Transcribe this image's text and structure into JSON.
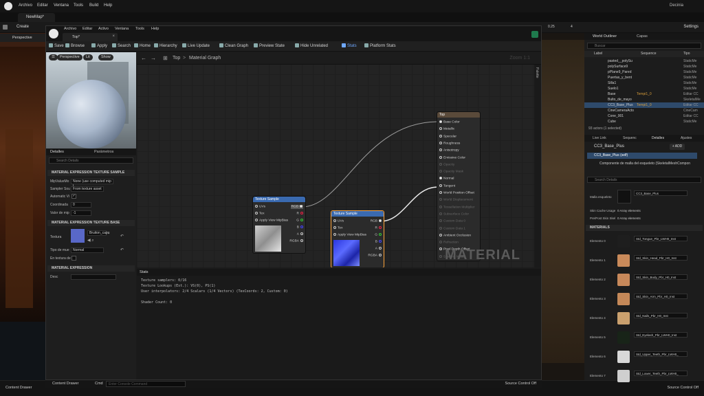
{
  "outer": {
    "menu": [
      "Archivo",
      "Editar",
      "Ventana",
      "Tools",
      "Build",
      "Help"
    ],
    "user": "Decinia",
    "map_tab": "NewMap*",
    "toolbar": {
      "create": "Create",
      "viewport_mode": "Perspective",
      "settings": "Settings",
      "fps": "0.25",
      "num": "4"
    },
    "bottom": {
      "content_drawer": "Content Drawer",
      "source_control": "Source Control Off"
    }
  },
  "mat": {
    "menu": [
      "Archivo",
      "Editar",
      "Activo",
      "Ventana",
      "Tools",
      "Help"
    ],
    "tab": "Top*",
    "toolbar": [
      "Save",
      "Browse",
      "Apply",
      "Search",
      "Home",
      "Hierarchy",
      "Live Update",
      "Clean Graph",
      "Preview State",
      "Hide Unrelated",
      "Stats",
      "Platform Stats"
    ],
    "viewport_pills": [
      "Perspective",
      "Lit",
      "Show"
    ],
    "details_tabs": [
      "Detalles",
      "Parámetros"
    ],
    "details_search": "Search Details",
    "sections": {
      "tex_sample": "MATERIAL EXPRESSION TEXTURE SAMPLE",
      "tex_base": "MATERIAL EXPRESSION TEXTURE BASE",
      "expr": "MATERIAL EXPRESSION"
    },
    "props": {
      "mip_label": "MipValueMo",
      "mip_value": "None (use computed mip l",
      "sampler_label": "Sampler Sou",
      "sampler_value": "From texture asset",
      "auto_label": "Automatic Vi",
      "coord_label": "Coordinada",
      "coord_value": "0",
      "const_label": "Valor de mip",
      "const_value": "-1",
      "texture_label": "Textura",
      "texture_value": "Bruiton_capu",
      "sampler_type_label": "Tipo de mue",
      "sampler_type_value": "Normal",
      "rangeunit_label": "En textura de",
      "desc_label": "Desc"
    },
    "graph": {
      "crumb_root": "Top",
      "crumb_sep": ">",
      "crumb_leaf": "Material Graph",
      "zoom": "Zoom 1:1",
      "watermark": "MATERIAL",
      "palette": "Palette"
    },
    "nodes": {
      "tex1_title": "Texture Sample",
      "tex2_title": "Texture Sample",
      "in_uvs": "UVs",
      "in_tex": "Tex",
      "in_mip": "Apply View MipBias",
      "out_rgb": "RGB",
      "out_r": "R",
      "out_g": "G",
      "out_b": "B",
      "out_a": "A",
      "out_rgba": "RGBA",
      "mat_title": "Top",
      "mat_pins": [
        {
          "label": "Base Color",
          "on": true
        },
        {
          "label": "Metallic",
          "on": true
        },
        {
          "label": "Specular",
          "on": true
        },
        {
          "label": "Roughness",
          "on": true
        },
        {
          "label": "Anisotropy",
          "on": true
        },
        {
          "label": "Emissive Color",
          "on": true
        },
        {
          "label": "Opacity",
          "on": false
        },
        {
          "label": "Opacity Mask",
          "on": false
        },
        {
          "label": "Normal",
          "on": true
        },
        {
          "label": "Tangent",
          "on": true
        },
        {
          "label": "World Position Offset",
          "on": true
        },
        {
          "label": "World Displacement",
          "on": false
        },
        {
          "label": "Tessellation Multiplier",
          "on": false
        },
        {
          "label": "Subsurface Color",
          "on": false
        },
        {
          "label": "Custom Data 0",
          "on": false
        },
        {
          "label": "Custom Data 1",
          "on": false
        },
        {
          "label": "Ambient Occlusion",
          "on": true
        },
        {
          "label": "Refraction",
          "on": false
        },
        {
          "label": "Pixel Depth Offset",
          "on": true
        },
        {
          "label": "Shading Model",
          "on": false
        }
      ]
    },
    "stats": {
      "tab": "Stats",
      "lines": [
        "Texture samplers: 0/16",
        "Texture Lookups (Est.): VS(0), PS(1)",
        "User interpolators: 2/4 Scalars (1/4 Vectors) (TexCoords: 2, Custom: 0)",
        "",
        "Shader Count: 0"
      ]
    },
    "bottom": {
      "content_drawer": "Content Drawer",
      "cmd": "Cmd",
      "cmd_placeholder": "Enter Console Command",
      "source_control": "Source Control Off"
    }
  },
  "outliner": {
    "tabs": [
      "World Outliner",
      "Capas"
    ],
    "search": "Buscar",
    "headers": {
      "label": "Label",
      "seq": "Sequence",
      "type": "Tipo"
    },
    "rows": [
      {
        "name": "pasted__polySu",
        "seq": "",
        "type": "StaticMe"
      },
      {
        "name": "polySurface9",
        "seq": "",
        "type": "StaticMe"
      },
      {
        "name": "pPlane9_Pared",
        "seq": "",
        "type": "StaticMe"
      },
      {
        "name": "Puertas_y_bent",
        "seq": "",
        "type": "StaticMe"
      },
      {
        "name": "Silla1",
        "seq": "",
        "type": "StaticMe"
      },
      {
        "name": "Suelo1",
        "seq": "",
        "type": "StaticMe"
      },
      {
        "name": "Base",
        "seq": "Tempi1_0",
        "type": "Editar CC"
      },
      {
        "name": "Bulto_de_mayo",
        "seq": "",
        "type": "SkeletalMe"
      },
      {
        "name": "CC3_Base_Plus",
        "seq": "Tempi1_0",
        "type": "Editar CC"
      },
      {
        "name": "CineCameraActo",
        "seq": "",
        "type": "CineCam"
      },
      {
        "name": "Cone_001",
        "seq": "",
        "type": "Editar CC"
      },
      {
        "name": "Cube",
        "seq": "",
        "type": "StaticMe"
      }
    ],
    "count": "93 actors (1 selected)"
  },
  "det": {
    "tabs": [
      "Live Link",
      "Sequenc",
      "Detalles",
      "Ajustes"
    ],
    "actor": "CC3_Base_Plus",
    "add": "+ ADD",
    "self": "CC3_Base_Plus (self)",
    "component": "Componente de malla del esqueleto (SkeletalMeshCompon",
    "search": "Search Details",
    "mesh_label": "Malla esqueleto",
    "mesh_value": "CC3_Base_Plus",
    "skin_label": "Skin Cache Usage",
    "skin_value": "0 Array elements",
    "prepost_label": "Pre/Post Skin Skel",
    "prepost_value": "0 Array elements",
    "materials_header": "MATERIALS",
    "elements": [
      {
        "label": "Elemento 0",
        "value": "Std_Tongue_Pbr_LWH0_Inst",
        "color": "#1e1e1e"
      },
      {
        "label": "Elemento 1",
        "value": "Std_Skin_Head_Pbr_H0_Inst",
        "color": "#c98a5a"
      },
      {
        "label": "Elemento 2",
        "value": "Std_Skin_Body_Pbr_H0_Inst",
        "color": "#c7885a"
      },
      {
        "label": "Elemento 3",
        "value": "Std_Skin_Arm_Pbr_H0_Inst",
        "color": "#c48858"
      },
      {
        "label": "Elemento 4",
        "value": "Std_Nails_Pbr_H0_Inst",
        "color": "#caa06e"
      },
      {
        "label": "Elemento 5",
        "value": "Std_Eyelash_Pbr_LWH0_Inst",
        "color": "#182418"
      },
      {
        "label": "Elemento 6",
        "value": "Std_Upper_Teeth_Pbr_LWH0_",
        "color": "#d8d8d8"
      },
      {
        "label": "Elemento 7",
        "value": "Std_Lower_Teeth_Pbr_LWH0_",
        "color": "#cfcfcf"
      }
    ]
  },
  "colors": {
    "accent": "#ffa53a",
    "selection": "#2e4a6b",
    "node_header": "#3a6ab0"
  }
}
